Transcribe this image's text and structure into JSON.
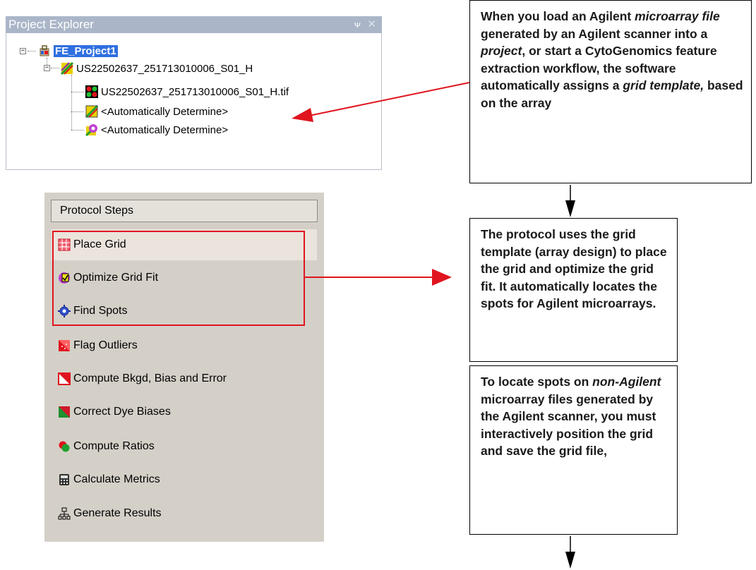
{
  "project_explorer": {
    "title": "Project Explorer",
    "pin_glyph": "↕",
    "close_glyph": "✕",
    "root_label": "FE_Project1",
    "scan_label": "US22502637_251713010006_S01_H",
    "children": [
      {
        "label": "US22502637_251713010006_S01_H.tif",
        "icon": "image-file-icon"
      },
      {
        "label": "<Automatically Determine>",
        "icon": "grid-template-icon"
      },
      {
        "label": "<Automatically Determine>",
        "icon": "protocol-icon"
      }
    ]
  },
  "protocol_steps": {
    "header": "Protocol Steps",
    "steps": [
      {
        "label": "Place Grid",
        "icon": "place-grid-icon"
      },
      {
        "label": "Optimize Grid Fit",
        "icon": "optimize-grid-fit-icon"
      },
      {
        "label": "Find Spots",
        "icon": "find-spots-icon"
      },
      {
        "label": "Flag Outliers",
        "icon": "flag-outliers-icon"
      },
      {
        "label": "Compute Bkgd, Bias and Error",
        "icon": "compute-bkgd-icon"
      },
      {
        "label": "Correct Dye Biases",
        "icon": "correct-dye-biases-icon"
      },
      {
        "label": "Compute Ratios",
        "icon": "compute-ratios-icon"
      },
      {
        "label": "Calculate Metrics",
        "icon": "calculate-metrics-icon"
      },
      {
        "label": "Generate Results",
        "icon": "generate-results-icon"
      }
    ]
  },
  "callouts": {
    "box1": {
      "p1": "When you load an Agilent ",
      "i1": "microarray file",
      "p2": " generated by an Agilent scanner into a ",
      "i2": "project",
      "p3": ", or start a CytoGenomics feature extraction workflow, the software automatically assigns a ",
      "i3": "grid template,",
      "p4": " based on the array"
    },
    "box2": {
      "text": "The protocol uses the grid template (array design) to place the grid and optimize the grid fit. It automatically locates the spots for Agilent microarrays."
    },
    "box3": {
      "p1": "To locate spots on ",
      "i1": "non-Agilent",
      "p2": " microarray files generated by the Agilent scanner, you must interactively position the grid and save the grid file,"
    }
  },
  "colors": {
    "title_bar": "#aab6c8",
    "selection": "#2f6fe0",
    "arrow_red": "#e0141e",
    "panel_bg": "#d4d0c8"
  }
}
